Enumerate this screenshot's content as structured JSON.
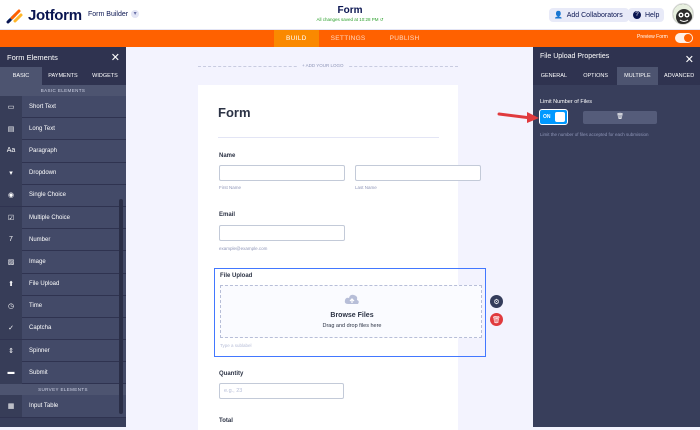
{
  "header": {
    "logo_text": "Jotform",
    "form_builder": "Form Builder",
    "form_title": "Form",
    "saved_status": "All changes saved at 10:28 PM",
    "collaborators_label": "Add Collaborators",
    "help_label": "Help"
  },
  "toolbar": {
    "tabs": [
      "BUILD",
      "SETTINGS",
      "PUBLISH"
    ],
    "active_tab": "BUILD",
    "preview_label": "Preview Form"
  },
  "left_panel": {
    "title": "Form Elements",
    "tabs": [
      "BASIC",
      "PAYMENTS",
      "WIDGETS"
    ],
    "basic_section": "BASIC ELEMENTS",
    "items": [
      {
        "label": "Short Text",
        "icon": "short-text-icon",
        "glyph": "▭"
      },
      {
        "label": "Long Text",
        "icon": "long-text-icon",
        "glyph": "▤"
      },
      {
        "label": "Paragraph",
        "icon": "paragraph-icon",
        "glyph": "Aa"
      },
      {
        "label": "Dropdown",
        "icon": "dropdown-icon",
        "glyph": "▾"
      },
      {
        "label": "Single Choice",
        "icon": "radio-icon",
        "glyph": "◉"
      },
      {
        "label": "Multiple Choice",
        "icon": "checkbox-icon",
        "glyph": "☑"
      },
      {
        "label": "Number",
        "icon": "number-icon",
        "glyph": "7"
      },
      {
        "label": "Image",
        "icon": "image-icon",
        "glyph": "▨"
      },
      {
        "label": "File Upload",
        "icon": "file-upload-icon",
        "glyph": "⬆"
      },
      {
        "label": "Time",
        "icon": "clock-icon",
        "glyph": "◷"
      },
      {
        "label": "Captcha",
        "icon": "captcha-icon",
        "glyph": "✓"
      },
      {
        "label": "Spinner",
        "icon": "spinner-icon",
        "glyph": "⇕"
      },
      {
        "label": "Submit",
        "icon": "submit-icon",
        "glyph": "▬"
      }
    ],
    "survey_section": "SURVEY ELEMENTS",
    "survey_items": [
      {
        "label": "Input Table",
        "icon": "table-icon",
        "glyph": "▦"
      }
    ]
  },
  "form": {
    "add_logo": "+ ADD YOUR LOGO",
    "title": "Form",
    "name_label": "Name",
    "first_name_hint": "First Name",
    "last_name_hint": "Last Name",
    "email_label": "Email",
    "email_hint": "example@example.com",
    "upload_label": "File Upload",
    "browse_label": "Browse Files",
    "drag_label": "Drag and drop files here",
    "sublabel_placeholder": "Type a sublabel",
    "quantity_label": "Quantity",
    "quantity_placeholder": "e.g., 23",
    "total_label": "Total"
  },
  "right_panel": {
    "title": "File Upload Properties",
    "tabs": [
      "GENERAL",
      "OPTIONS",
      "MULTIPLE",
      "ADVANCED"
    ],
    "active_tab": "MULTIPLE",
    "limit_label": "Limit Number of Files",
    "toggle_label": "ON",
    "help_text": "Limit the number of files accepted for each submission"
  },
  "colors": {
    "accent_orange": "#ff6100",
    "panel_bg": "#383e5b",
    "focus_blue": "#4277ff",
    "toggle_blue": "#0099ff",
    "arrow_red": "#e03a3e",
    "delete_red": "#e03a3e"
  }
}
